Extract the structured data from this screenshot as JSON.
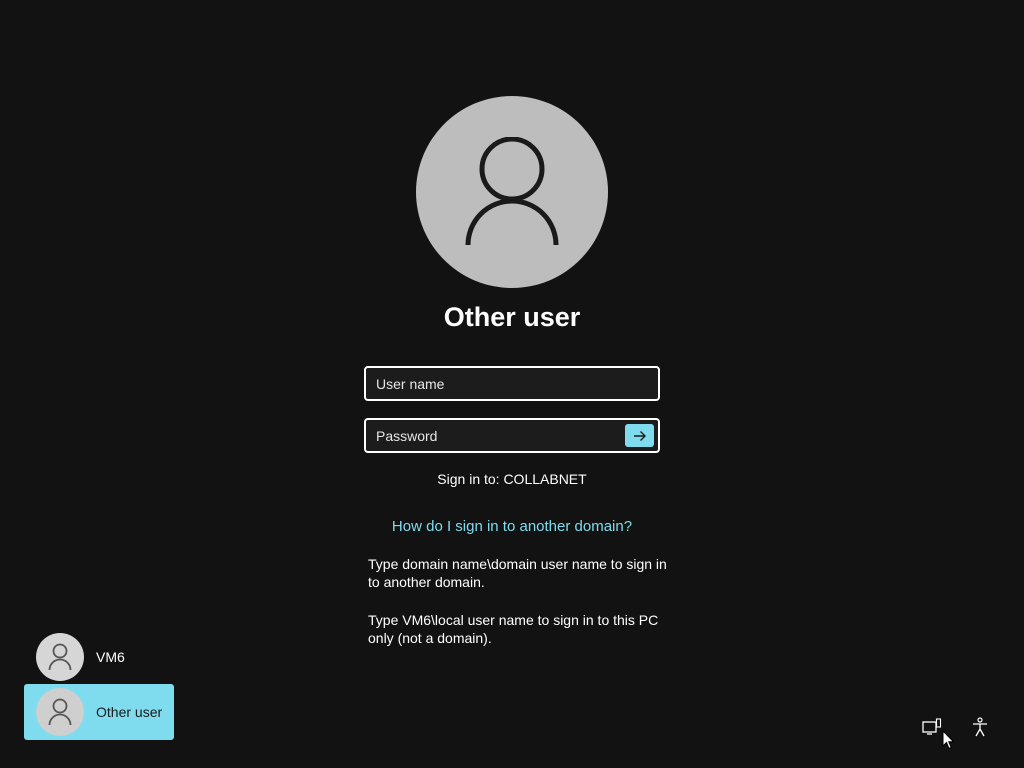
{
  "login": {
    "title": "Other user",
    "username_placeholder": "User name",
    "password_placeholder": "Password",
    "submit_icon": "arrow-right-icon",
    "sign_in_to": "Sign in to: COLLABNET",
    "domain_link": "How do I sign in to another domain?",
    "help_text_1": "Type domain name\\domain user name to sign in to another domain.",
    "help_text_2": "Type VM6\\local user name to sign in to this PC only (not a domain)."
  },
  "users": [
    {
      "label": "VM6",
      "icon": "user-icon",
      "selected": false
    },
    {
      "label": "Other user",
      "icon": "user-icon",
      "selected": true
    }
  ],
  "system_tray": {
    "network_icon": "network-icon",
    "accessibility_icon": "accessibility-icon"
  },
  "colors": {
    "background": "#121212",
    "accent": "#7fdcef",
    "avatar_gray": "#bdbdbd",
    "text": "#ffffff"
  }
}
